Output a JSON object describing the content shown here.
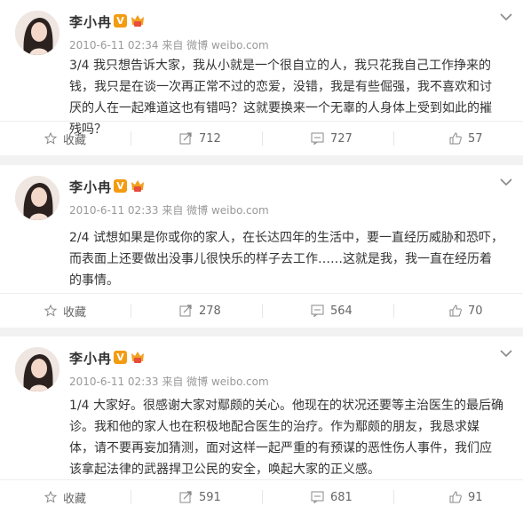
{
  "posts": [
    {
      "author": "李小冉",
      "verified_badge": "V",
      "meta": "2010-6-11 02:34 来自 微博 weibo.com",
      "text": "3/4 我只想告诉大家，我从小就是一个很自立的人，我只花我自己工作挣来的钱，我只是在谈一次再正常不过的恋爱，没错，我是有些倔强，我不喜欢和讨厌的人在一起难道这也有错吗？这就要换来一个无辜的人身体上受到如此的摧残吗？",
      "actions": {
        "favorite": "收藏",
        "forward": "712",
        "comment": "727",
        "like": "57"
      }
    },
    {
      "author": "李小冉",
      "verified_badge": "V",
      "meta": "2010-6-11 02:33 来自 微博 weibo.com",
      "text": "2/4 试想如果是你或你的家人，在长达四年的生活中，要一直经历威胁和恐吓，而表面上还要做出没事儿很快乐的样子去工作……这就是我，我一直在经历着的事情。",
      "actions": {
        "favorite": "收藏",
        "forward": "278",
        "comment": "564",
        "like": "70"
      }
    },
    {
      "author": "李小冉",
      "verified_badge": "V",
      "meta": "2010-6-11 02:33 来自 微博 weibo.com",
      "text": "1/4 大家好。很感谢大家对鄢颇的关心。他现在的状况还要等主治医生的最后确诊。我和他的家人也在积极地配合医生的治疗。作为鄢颇的朋友，我恳求媒体，请不要再妄加猜测，面对这样一起严重的有预谋的恶性伤人事件，我们应该拿起法律的武器捍卫公民的安全，唤起大家的正义感。",
      "actions": {
        "favorite": "收藏",
        "forward": "591",
        "comment": "681",
        "like": "91"
      }
    }
  ],
  "colors": {
    "badge": "#f39c12",
    "muted": "#999999",
    "background": "#f2f2f2"
  },
  "icons": [
    "avatar",
    "verified-badge-icon",
    "vip-badge-icon",
    "chevron-down-icon",
    "star-icon",
    "forward-icon",
    "comment-icon",
    "like-icon"
  ]
}
